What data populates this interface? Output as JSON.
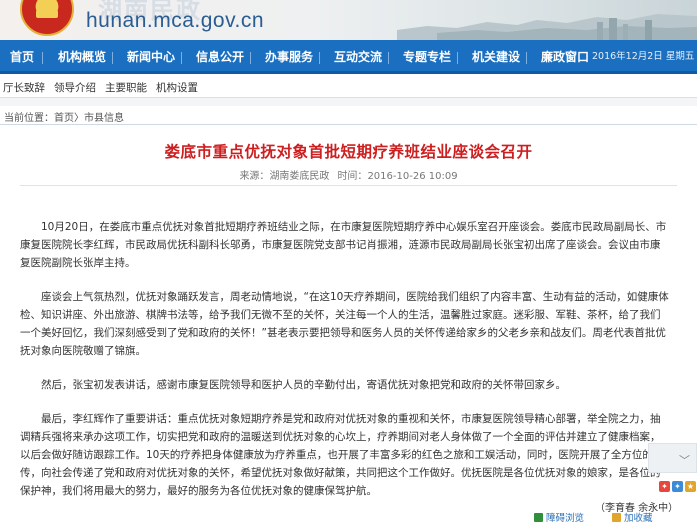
{
  "header": {
    "domain": "hunan.mca.gov.cn",
    "title_ghost": "湖南民政"
  },
  "mainnav": {
    "items": [
      "首页",
      "机构概览",
      "新闻中心",
      "信息公开",
      "办事服务",
      "互动交流",
      "专题专栏",
      "机关建设",
      "廉政窗口"
    ],
    "date": "2016年12月2日 星期五"
  },
  "subnav": {
    "items": [
      "厅长致辞",
      "领导介绍",
      "主要职能",
      "机构设置"
    ]
  },
  "breadcrumb": {
    "prefix": "当前位置：",
    "home": "首页",
    "sep1": "〉",
    "section": "市县信息"
  },
  "article": {
    "title": "娄底市重点优抚对象首批短期疗养班结业座谈会召开",
    "source_label": "来源：",
    "source": "湖南娄底民政",
    "time_label": "时间：",
    "time": "2016-10-26 10:09",
    "paragraphs": [
      "10月20日，在娄底市重点优抚对象首批短期疗养班结业之际，在市康复医院短期疗养中心娱乐室召开座谈会。娄底市民政局副局长、市康复医院院长李红辉，市民政局优抚科副科长邬勇，市康复医院党支部书记肖振湘，涟源市民政局副局长张宝初出席了座谈会。会议由市康复医院副院长张岸主持。",
      "座谈会上气氛热烈，优抚对象踊跃发言，周老动情地说，“在这10天疗养期间，医院给我们组织了内容丰富、生动有益的活动，如健康体检、知识讲座、外出旅游、棋牌书法等，给予我们无微不至的关怀，关注每一个人的生活，温馨胜过家庭。迷彩服、军鞋、茶杯，给了我们一个美好回忆，我们深刻感受到了党和政府的关怀！”甚老表示要把领导和医务人员的关怀传递给家乡的父老乡亲和战友们。周老代表首批优抚对象向医院敬赠了锦旗。",
      "然后，张宝初发表讲话，感谢市康复医院领导和医护人员的辛勤付出，寄语优抚对象把党和政府的关怀带回家乡。",
      "最后，李红辉作了重要讲话：重点优抚对象短期疗养是党和政府对优抚对象的重视和关怀，市康复医院领导精心部署，举全院之力，抽调精兵强将来承办这项工作，切实把党和政府的温暖送到优抚对象的心坎上，疗养期间对老人身体做了一个全面的评估并建立了健康档案，以后会做好随访跟踪工作。10天的疗养把身体健康放为疗养重点，也开展了丰富多彩的红色之旅和工娱活动，同时，医院开展了全方位的宣传，向社会传递了党和政府对优抚对象的关怀，希望优抚对象做好献策，共同把这个工作做好。优抚医院是各位优抚对象的娘家，是各位的保护神，我们将用最大的努力，最好的服务为各位优抚对象的健康保驾护航。"
    ],
    "author": "（李育春 余永中）"
  },
  "toolbar": {
    "easy_read": "障碍浏览",
    "favorite": "加收藏"
  },
  "colors": {
    "nav_blue": "#1a6fc1",
    "title_red": "#cd1e20",
    "domain_blue": "#2a5d91"
  }
}
